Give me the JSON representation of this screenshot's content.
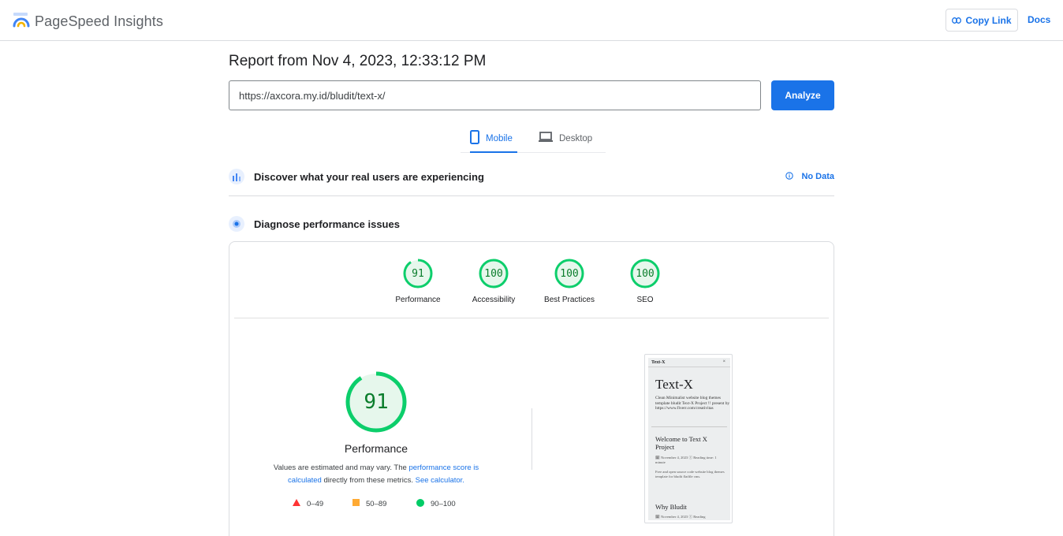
{
  "header": {
    "app_title": "PageSpeed Insights",
    "copy_link_label": "Copy Link",
    "docs_label": "Docs"
  },
  "report": {
    "title": "Report from Nov 4, 2023, 12:33:12 PM"
  },
  "form": {
    "url_value": "https://axcora.my.id/bludit/text-x/",
    "analyze_label": "Analyze"
  },
  "tabs": [
    {
      "label": "Mobile",
      "icon": "phone-icon",
      "selected": true
    },
    {
      "label": "Desktop",
      "icon": "laptop-icon",
      "selected": false
    }
  ],
  "crux": {
    "title": "Discover what your real users are experiencing",
    "status": "No Data"
  },
  "diagnose": {
    "title": "Diagnose performance issues"
  },
  "scores": [
    {
      "label": "Performance",
      "value": "91",
      "fraction": 0.91
    },
    {
      "label": "Accessibility",
      "value": "100",
      "fraction": 1.0
    },
    {
      "label": "Best Practices",
      "value": "100",
      "fraction": 1.0
    },
    {
      "label": "SEO",
      "value": "100",
      "fraction": 1.0
    }
  ],
  "main_score": {
    "value": "91",
    "fraction": 0.91,
    "label": "Performance"
  },
  "disclaimer": {
    "prefix": "Values are estimated and may vary. The ",
    "link1": "performance score is calculated",
    "middle": " directly from these metrics. ",
    "link2": "See calculator.",
    "suffix": ""
  },
  "legend": [
    {
      "range": "0–49",
      "shape": "triangle",
      "color": "#f33"
    },
    {
      "range": "50–89",
      "shape": "square",
      "color": "#fa3"
    },
    {
      "range": "90–100",
      "shape": "circle",
      "color": "#0c6"
    }
  ],
  "colors": {
    "accent": "#1a73e8",
    "pass_green": "#0cce6b",
    "pass_text": "#0a7d2c",
    "pass_bg": "#e6f7ec"
  },
  "screenshot": {
    "nav_brand": "Text-X",
    "nav_close": "×",
    "site_title": "Text-X",
    "site_description": "Clean Minimalist website blog themes template bludit Text-X Project !! present by https://www.fiverr.com/creativitas",
    "post1_title": "Welcome to Text X Project",
    "post1_meta": "🗓 November 4, 2023   ⓒ Reading time: 1 minute",
    "post1_excerpt": "Free and open source code website blog themes template for bludit flatfile cms.",
    "post2_title": "Why Bludit",
    "post2_meta": "🗓 November 4, 2023   ⓒ Reading"
  }
}
